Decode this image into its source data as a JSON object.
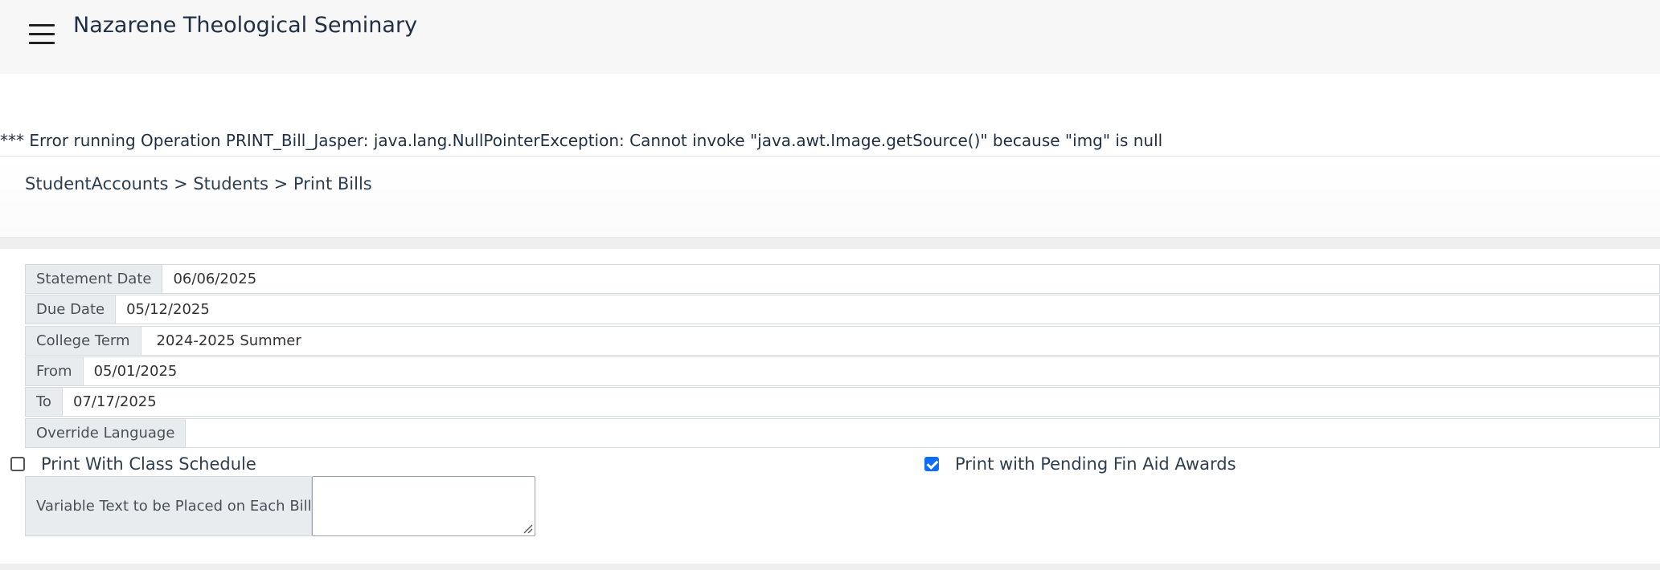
{
  "app": {
    "title": "Nazarene Theological Seminary"
  },
  "error": {
    "message": "*** Error running Operation PRINT_Bill_Jasper: java.lang.NullPointerException: Cannot invoke \"java.awt.Image.getSource()\" because \"img\" is null"
  },
  "breadcrumb": {
    "text": "StudentAccounts > Students > Print Bills"
  },
  "form": {
    "statement_date": {
      "label": "Statement Date",
      "value": "06/06/2025"
    },
    "due_date": {
      "label": "Due Date",
      "value": "05/12/2025"
    },
    "college_term": {
      "label": "College Term",
      "value": "2024-2025 Summer"
    },
    "from": {
      "label": "From",
      "value": "05/01/2025"
    },
    "to": {
      "label": "To",
      "value": "07/17/2025"
    },
    "override_language": {
      "label": "Override Language",
      "value": ""
    },
    "print_with_class_schedule": {
      "label": "Print With Class Schedule",
      "checked": false
    },
    "print_with_pending_fin_aid": {
      "label": "Print with Pending Fin Aid Awards",
      "checked": true
    },
    "variable_text": {
      "label": "Variable Text to be Placed on Each Bill",
      "value": ""
    }
  },
  "icons": {
    "menu": "hamburger-menu-icon",
    "checkbox_checked": "checkmark-icon",
    "resize": "resize-grip-icon"
  },
  "colors": {
    "accent": "#0d6efd",
    "label_bg": "#e9ecef",
    "topbar_bg": "#f7f7f7"
  }
}
